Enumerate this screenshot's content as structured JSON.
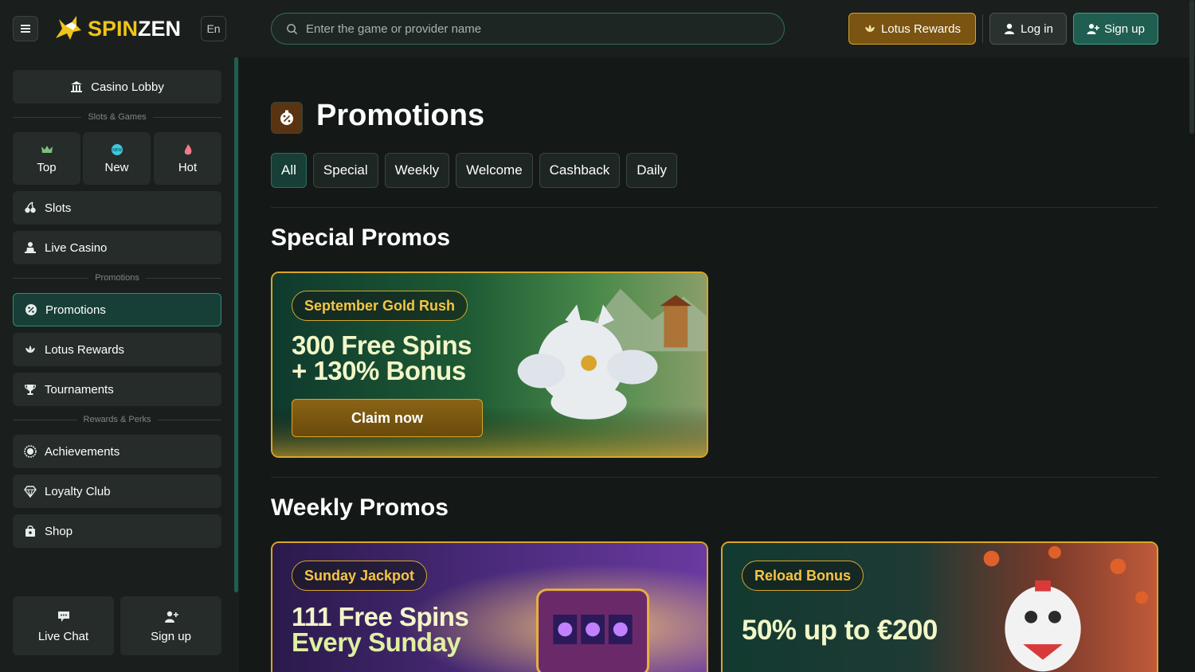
{
  "brand": {
    "spin": "SPIN",
    "zen": "ZEN",
    "lang": "En"
  },
  "search": {
    "placeholder": "Enter the game or provider name"
  },
  "header": {
    "rewards_label": "Lotus Rewards",
    "login_label": "Log in",
    "signup_label": "Sign up"
  },
  "sidebar": {
    "lobby": "Casino Lobby",
    "sep_games": "Slots & Games",
    "tiles": [
      {
        "label": "Top",
        "icon": "crown-icon"
      },
      {
        "label": "New",
        "icon": "new-badge-icon"
      },
      {
        "label": "Hot",
        "icon": "flame-icon"
      }
    ],
    "slots": "Slots",
    "live_casino": "Live Casino",
    "sep_promos": "Promotions",
    "promotions": "Promotions",
    "lotus_rewards": "Lotus Rewards",
    "tournaments": "Tournaments",
    "sep_rewards": "Rewards & Perks",
    "achievements": "Achievements",
    "loyalty": "Loyalty Club",
    "shop": "Shop",
    "live_chat": "Live Chat",
    "sign_up": "Sign up"
  },
  "main": {
    "title": "Promotions",
    "tabs": [
      "All",
      "Special",
      "Weekly",
      "Welcome",
      "Cashback",
      "Daily"
    ],
    "active_tab": "All",
    "special_title": "Special Promos",
    "weekly_title": "Weekly Promos",
    "special": [
      {
        "tag": "September Gold Rush",
        "line1": "300 Free Spins",
        "line2": "+ 130% Bonus",
        "cta": "Claim now"
      }
    ],
    "weekly": [
      {
        "tag": "Sunday Jackpot",
        "line1": "111 Free Spins",
        "line2": "Every Sunday"
      },
      {
        "tag": "Reload Bonus",
        "line1": "50% up to €200"
      }
    ]
  },
  "colors": {
    "accent_gold": "#d8a52a",
    "accent_green": "#1f5e50",
    "bg": "#141918"
  }
}
